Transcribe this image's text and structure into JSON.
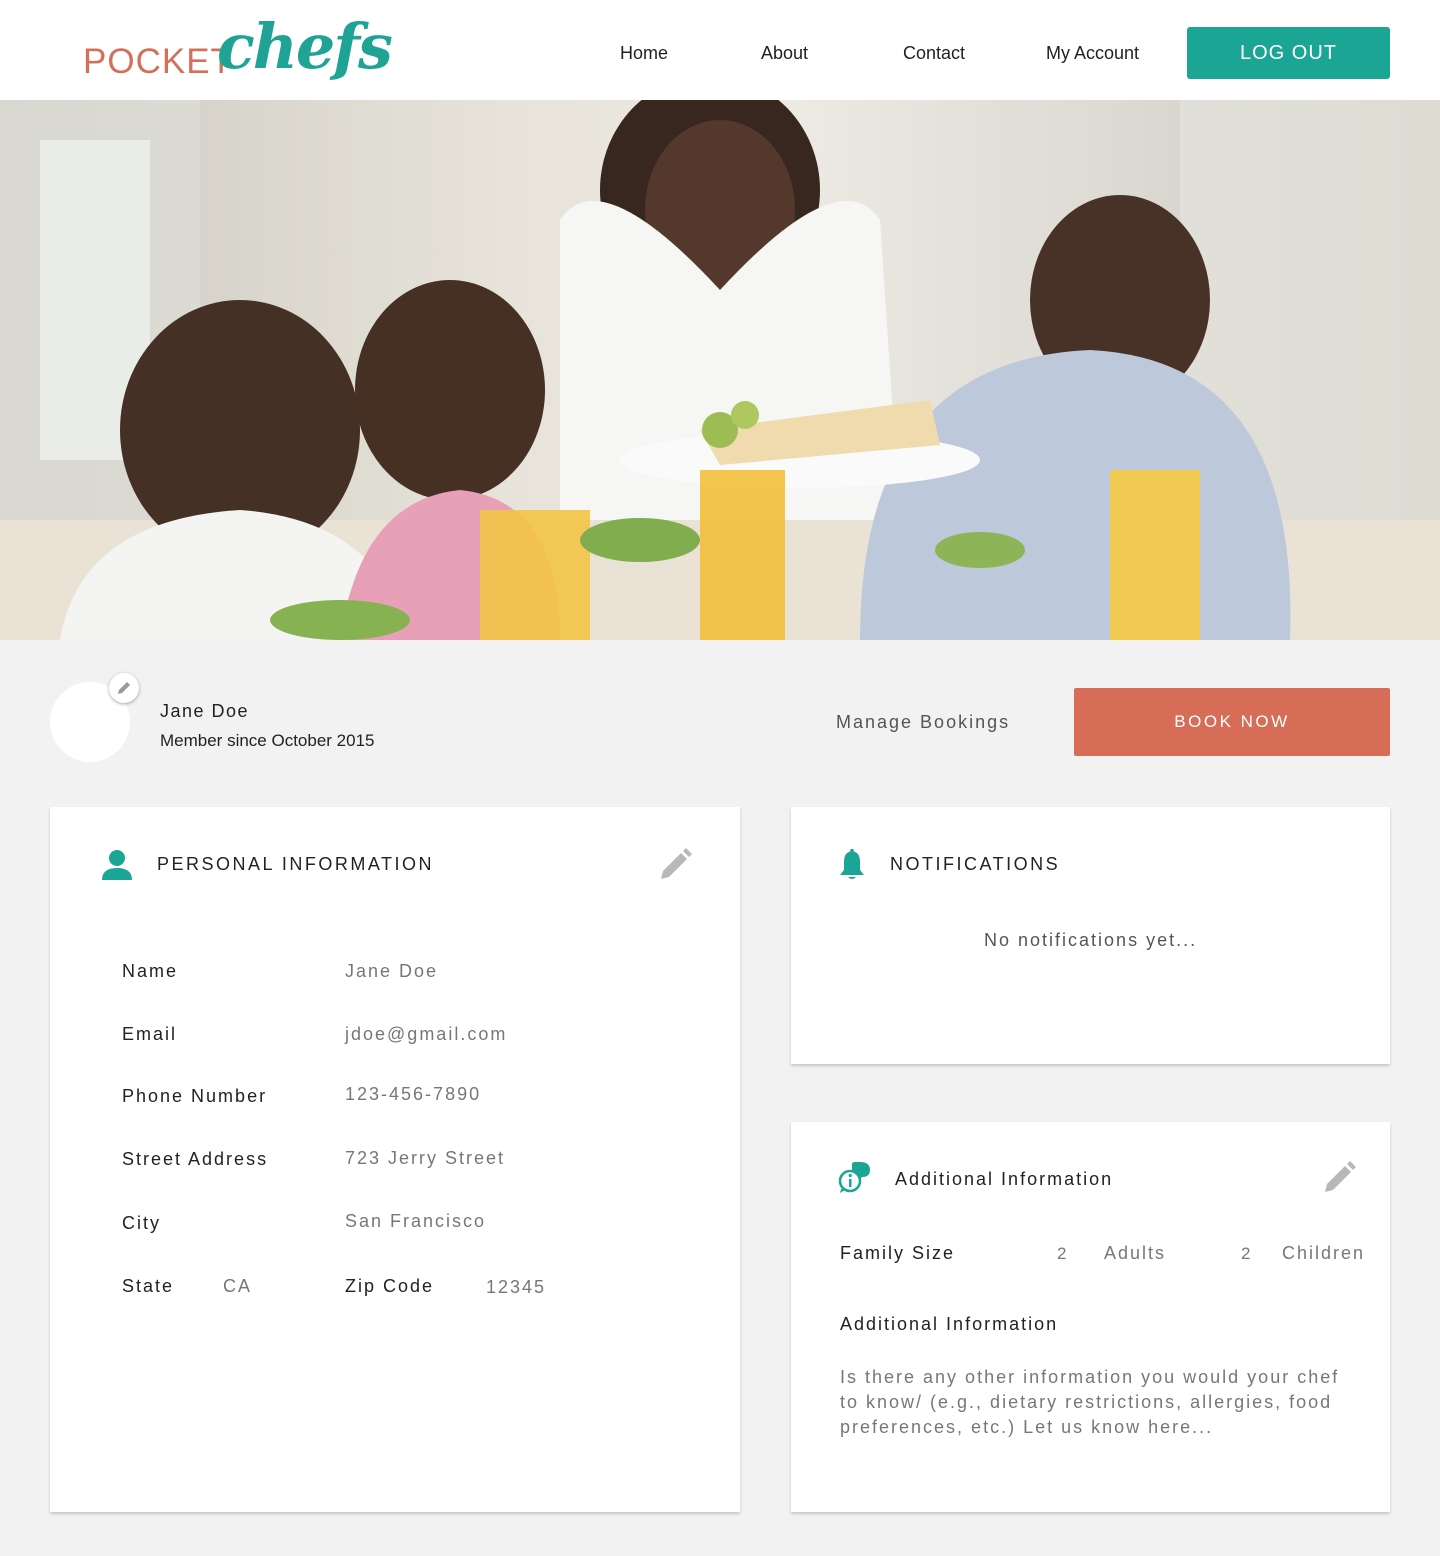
{
  "brand": {
    "name_part1": "POCKET",
    "name_part2": "chefs",
    "primary_color": "#1aa595",
    "accent_color": "#d76d56"
  },
  "nav": {
    "links": [
      "Home",
      "About",
      "Contact",
      "My Account"
    ],
    "logout_label": "LOG OUT"
  },
  "hero": {
    "description": "family-dinner-photo"
  },
  "profile": {
    "name": "Jane Doe",
    "member_since": "Member since October 2015",
    "manage_bookings_label": "Manage Bookings",
    "book_now_label": "BOOK NOW"
  },
  "personal_info": {
    "title": "PERSONAL INFORMATION",
    "fields": [
      {
        "label": "Name",
        "value": "Jane Doe"
      },
      {
        "label": "Email",
        "value": "jdoe@gmail.com"
      },
      {
        "label": "Phone Number",
        "value": "123-456-7890"
      },
      {
        "label": "Street Address",
        "value": "723 Jerry Street"
      },
      {
        "label": "City",
        "value": "San Francisco"
      }
    ],
    "state_label": "State",
    "state_value": "CA",
    "zip_label": "Zip Code",
    "zip_value": "12345"
  },
  "notifications": {
    "title": "NOTIFICATIONS",
    "empty_message": "No notifications yet..."
  },
  "additional_info": {
    "title": "Additional Information",
    "family_size_label": "Family Size",
    "adults_count": "2",
    "adults_label": "Adults",
    "children_count": "2",
    "children_label": "Children",
    "notes_label": "Additional Information",
    "notes_placeholder": "Is there any other information you would your chef to know/ (e.g., dietary restrictions, allergies, food preferences, etc.) Let us know here..."
  }
}
